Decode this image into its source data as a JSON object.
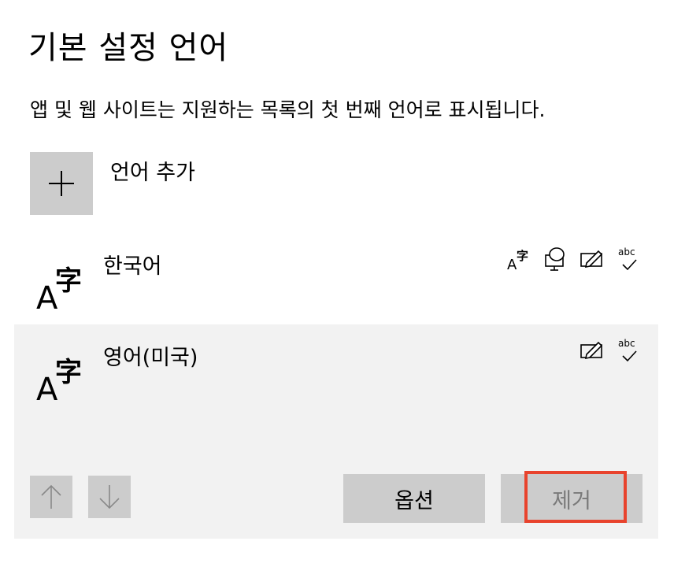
{
  "header": {
    "title": "기본 설정 언어",
    "description": "앱 및 웹 사이트는 지원하는 목록의 첫 번째 언어로 표시됩니다."
  },
  "add_language": {
    "label": "언어 추가"
  },
  "languages": [
    {
      "name": "한국어",
      "features": [
        "display-language-icon",
        "speech-icon",
        "handwriting-icon",
        "spelling-icon"
      ]
    },
    {
      "name": "영어(미국)",
      "features": [
        "handwriting-icon",
        "spelling-icon"
      ],
      "selected": true
    }
  ],
  "feature_text": {
    "display_glyph": "字",
    "abc": "abc"
  },
  "actions": {
    "options_label": "옵션",
    "remove_label": "제거"
  },
  "colors": {
    "highlight": "#e8432d",
    "button_bg": "#cccccc",
    "selected_row_bg": "#f2f2f2",
    "disabled_text": "#7a7a7a"
  }
}
